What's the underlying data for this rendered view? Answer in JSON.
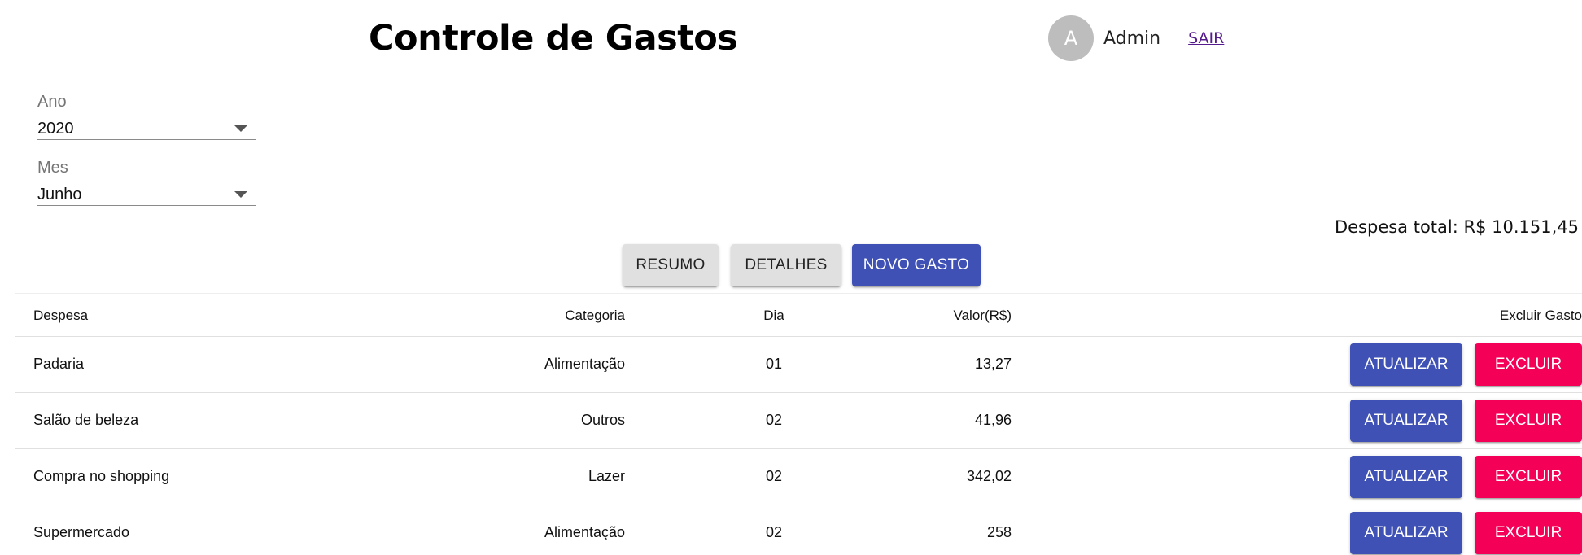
{
  "header": {
    "title": "Controle de Gastos",
    "user": {
      "avatar_letter": "A",
      "name": "Admin",
      "logout_label": "SAIR"
    }
  },
  "filters": {
    "year": {
      "label": "Ano",
      "value": "2020"
    },
    "month": {
      "label": "Mes",
      "value": "Junho"
    }
  },
  "summary": {
    "total": "Despesa total: R$ 10.151,45"
  },
  "actions": {
    "resumo": "RESUMO",
    "detalhes": "DETALHES",
    "novo_gasto": "NOVO GASTO"
  },
  "table": {
    "columns": {
      "despesa": "Despesa",
      "categoria": "Categoria",
      "dia": "Dia",
      "valor": "Valor(R$)",
      "excluir": "Excluir Gasto"
    },
    "update_label": "ATUALIZAR",
    "delete_label": "EXCLUIR",
    "rows": [
      {
        "despesa": "Padaria",
        "categoria": "Alimentação",
        "dia": "01",
        "valor": "13,27"
      },
      {
        "despesa": "Salão de beleza",
        "categoria": "Outros",
        "dia": "02",
        "valor": "41,96"
      },
      {
        "despesa": "Compra no shopping",
        "categoria": "Lazer",
        "dia": "02",
        "valor": "342,02"
      },
      {
        "despesa": "Supermercado",
        "categoria": "Alimentação",
        "dia": "02",
        "valor": "258"
      }
    ]
  },
  "colors": {
    "primary": "#3f51b5",
    "secondary": "#f50057",
    "neutral_button": "#e0e0e0",
    "avatar": "#bdbdbd"
  }
}
